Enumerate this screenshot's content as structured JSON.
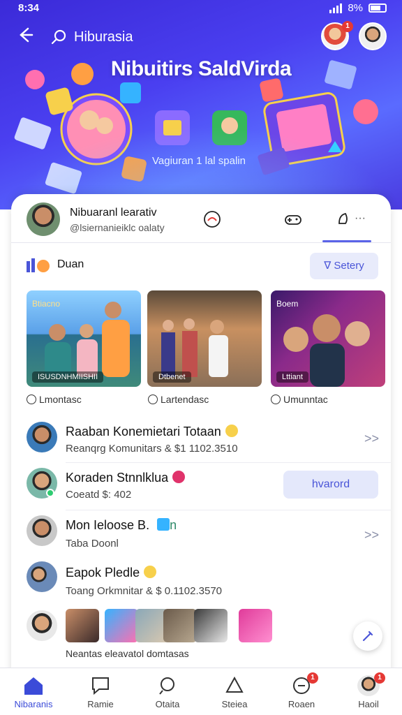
{
  "status_bar": {
    "time": "8:34",
    "battery": "8%"
  },
  "topbar": {
    "back_icon": "arrow-left-icon",
    "search_icon": "search-icon",
    "title": "Hiburasia",
    "notification_badge": "1"
  },
  "hero": {
    "headline": "Nibuitirs SaldVirda",
    "sub": "Vagiuran 1 lal spalin",
    "colors": {
      "gradient_start": "#3b2ad8",
      "gradient_end": "#5a6bff"
    }
  },
  "profile": {
    "name": "Nibuaranl learativ",
    "handle": "@lsiernanieiklc oalaty",
    "tabs": [
      "activity-icon",
      "gamepad-icon",
      "feed-icon"
    ],
    "tab_dots": "···"
  },
  "section": {
    "title": "Duan",
    "sort_label": "Setery"
  },
  "photos": [
    {
      "tag": "Btiacno",
      "overlay": "ISUSDNHMIISHII",
      "caption": "Lmontasc"
    },
    {
      "tag": "",
      "overlay": "Dtbenet",
      "caption": "Lartendasc"
    },
    {
      "tag": "Boem",
      "overlay": "Lttiant",
      "caption": "Umunntac"
    }
  ],
  "list": [
    {
      "title": "Raaban Konemietari Totaan",
      "sub": "Reanqrg Komunitars & $1 1102.3510",
      "action": ">>"
    },
    {
      "title": "Koraden Stnnlklua",
      "sub": "Coeatd $: 402",
      "action": "hvarord"
    },
    {
      "title": "Mon Ieloose B.",
      "title_suffix": "n",
      "sub": "Taba Doonl",
      "action": ">>"
    },
    {
      "title": "Eapok Pledle",
      "sub": "Toang Orkmnitar & $ 0.1102.3570",
      "action": ""
    }
  ],
  "strip": {
    "caption": "Neantas eleavatol domtasas",
    "fab_icon": "pencil-icon"
  },
  "bottom_nav": [
    {
      "label": "Nibaranis",
      "icon": "home-icon",
      "active": true
    },
    {
      "label": "Ramie",
      "icon": "chat-icon"
    },
    {
      "label": "Otaita",
      "icon": "search-icon"
    },
    {
      "label": "Steiea",
      "icon": "bookmark-icon"
    },
    {
      "label": "Roaen",
      "icon": "messages-icon",
      "badge": "1"
    },
    {
      "label": "Haoil",
      "icon": "profile-icon",
      "badge": "1"
    }
  ]
}
